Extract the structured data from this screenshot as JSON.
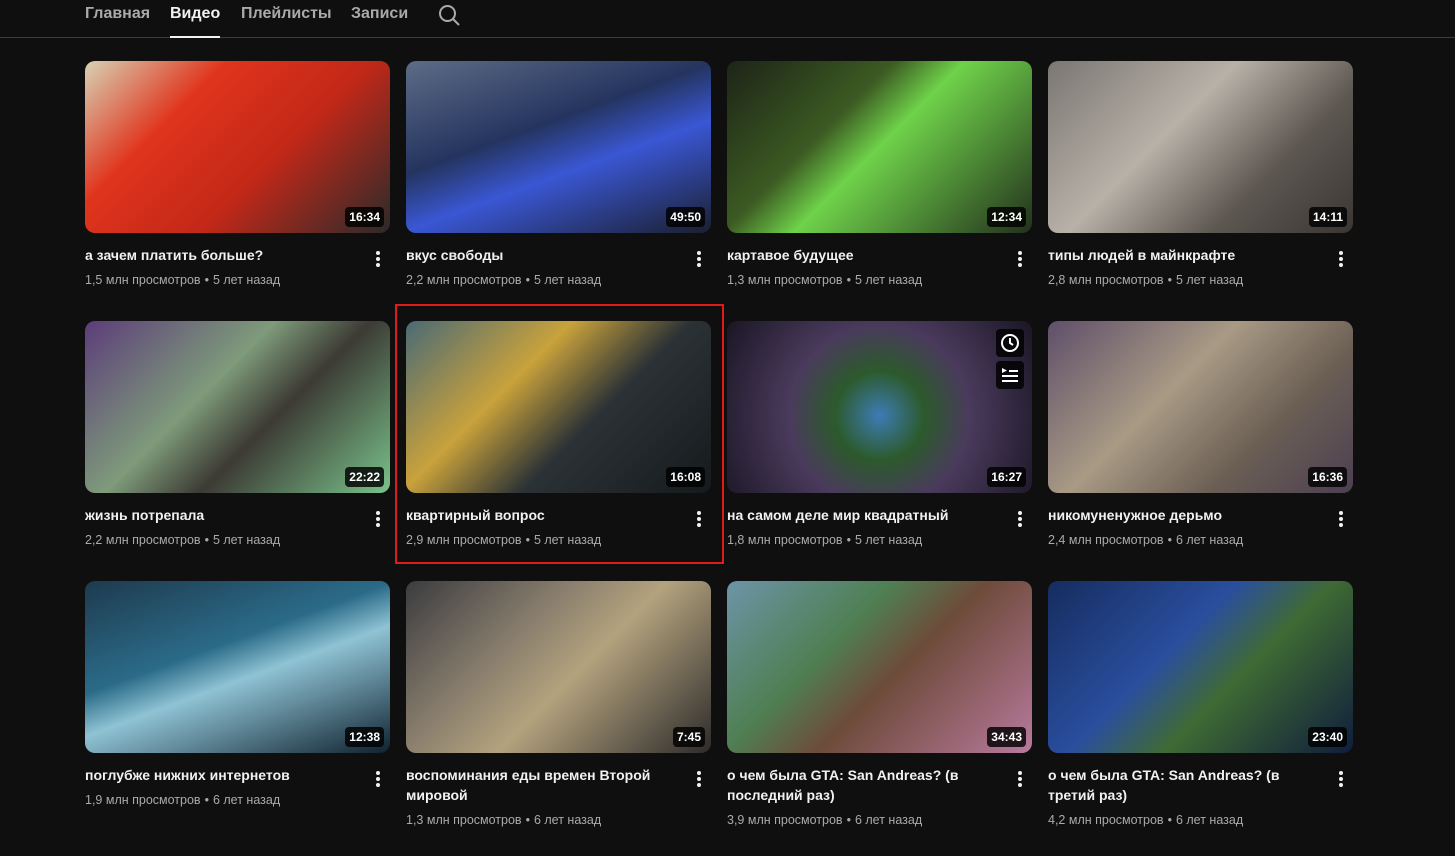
{
  "tabs": [
    "Главная",
    "Видео",
    "Плейлисты",
    "Записи"
  ],
  "active_tab": "Видео",
  "colors": {
    "background": "#0f0f0f",
    "text": "#f1f1f1",
    "secondary": "#aaaaaa",
    "highlight": "#e01b1b"
  },
  "hover_icons": [
    "clock-icon",
    "add-to-queue-icon"
  ],
  "videos": [
    {
      "title": "а зачем платить больше?",
      "views": "1,5 млн просмотров",
      "age": "5 лет назад",
      "duration": "16:34",
      "thumb": "linear-gradient(135deg,#d7d2b5 0%,#e0341c 30%,#c22818 60%,#2a2a2a 100%)"
    },
    {
      "title": "вкус свободы",
      "views": "2,2 млн просмотров",
      "age": "5 лет назад",
      "duration": "49:50",
      "thumb": "linear-gradient(160deg,#5d6c86 0%,#24345f 40%,#3a57d4 60%,#1b1f2f 100%)"
    },
    {
      "title": "картавое будущее",
      "views": "1,3 млн просмотров",
      "age": "5 лет назад",
      "duration": "12:34",
      "thumb": "linear-gradient(135deg,#1d2418 0%,#3c5a22 35%,#6fd24a 50%,#23301d 100%)"
    },
    {
      "title": "типы людей в майнкрафте",
      "views": "2,8 млн просмотров",
      "age": "5 лет назад",
      "duration": "14:11",
      "thumb": "linear-gradient(135deg,#7a7672 0%,#b8b1a8 40%,#5d5751 70%,#3a3633 100%)"
    },
    {
      "title": "жизнь потрепала",
      "views": "2,2 млн просмотров",
      "age": "5 лет назад",
      "duration": "22:22",
      "thumb": "linear-gradient(135deg,#5c3d7a 0%,#7e9b7a 40%,#3c3a34 60%,#7ac28a 100%)"
    },
    {
      "title": "квартирный вопрос",
      "views": "2,9 млн просмотров",
      "age": "5 лет назад",
      "duration": "16:08",
      "thumb": "linear-gradient(135deg,#4a6a75 0%,#c9a23b 35%,#2b3236 60%,#151a1c 100%)"
    },
    {
      "title": "на самом деле мир квадратный",
      "views": "1,8 млн просмотров",
      "age": "5 лет назад",
      "duration": "16:27",
      "thumb": "radial-gradient(circle at 50% 55%,#3d7cb5 0%,#2c5a2c 25%,#4a3a5c 50%,#1a1624 100%)",
      "hover": true
    },
    {
      "title": "никомуненужное дерьмо",
      "views": "2,4 млн просмотров",
      "age": "6 лет назад",
      "duration": "16:36",
      "thumb": "linear-gradient(135deg,#5f4f6a 0%,#a89a84 40%,#6a5e54 70%,#4c3f52 100%)"
    },
    {
      "title": "поглубже нижних интернетов",
      "views": "1,9 млн просмотров",
      "age": "6 лет назад",
      "duration": "12:38",
      "thumb": "linear-gradient(160deg,#1e3a4e 0%,#2b6b88 40%,#8fc3d4 55%,#102230 100%)"
    },
    {
      "title": "воспоминания еды времен Второй мировой",
      "views": "1,3 млн просмотров",
      "age": "6 лет назад",
      "duration": "7:45",
      "thumb": "linear-gradient(135deg,#3b3b3f 0%,#8a7f6e 35%,#b3a27d 55%,#2d2b2b 100%)"
    },
    {
      "title": "о чем была GTA: San Andreas? (в последний раз)",
      "views": "3,9 млн просмотров",
      "age": "6 лет назад",
      "duration": "34:43",
      "thumb": "linear-gradient(135deg,#6c94a8 0%,#4f7f52 35%,#6e4b3a 55%,#b87a9e 100%)"
    },
    {
      "title": "о чем была GTA: San Andreas? (в третий раз)",
      "views": "4,2 млн просмотров",
      "age": "6 лет назад",
      "duration": "23:40",
      "thumb": "linear-gradient(135deg,#152c5e 0%,#2a4e9e 40%,#3f6a34 60%,#0f1d3c 100%)"
    }
  ]
}
